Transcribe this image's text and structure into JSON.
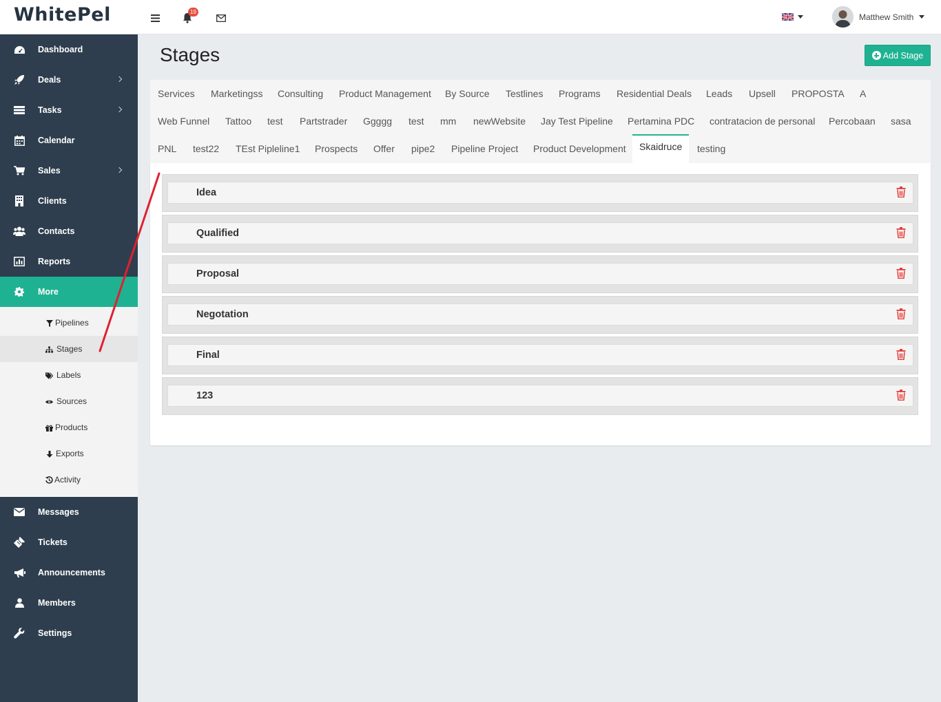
{
  "app": {
    "logo": "WhitePel"
  },
  "topbar": {
    "notification_count": "19",
    "user_name": "Matthew Smith"
  },
  "sidebar": {
    "items": [
      {
        "label": "Dashboard",
        "icon": "dashboard-icon"
      },
      {
        "label": "Deals",
        "icon": "rocket-icon"
      },
      {
        "label": "Tasks",
        "icon": "tasks-icon"
      },
      {
        "label": "Calendar",
        "icon": "calendar-icon"
      },
      {
        "label": "Sales",
        "icon": "cart-icon"
      },
      {
        "label": "Clients",
        "icon": "building-icon"
      },
      {
        "label": "Contacts",
        "icon": "users-icon"
      },
      {
        "label": "Reports",
        "icon": "bar-chart-icon"
      },
      {
        "label": "More",
        "icon": "gear-icon"
      },
      {
        "label": "Messages",
        "icon": "envelope-icon"
      },
      {
        "label": "Tickets",
        "icon": "ticket-icon"
      },
      {
        "label": "Announcements",
        "icon": "bullhorn-icon"
      },
      {
        "label": "Members",
        "icon": "user-icon"
      },
      {
        "label": "Settings",
        "icon": "wrench-icon"
      }
    ],
    "submenu": [
      {
        "label": "Pipelines",
        "icon": "filter-icon"
      },
      {
        "label": "Stages",
        "icon": "sitemap-icon"
      },
      {
        "label": "Labels",
        "icon": "tags-icon"
      },
      {
        "label": "Sources",
        "icon": "eye-icon"
      },
      {
        "label": "Products",
        "icon": "gift-icon"
      },
      {
        "label": "Exports",
        "icon": "arrow-down-icon"
      },
      {
        "label": "Activity",
        "icon": "history-icon"
      }
    ]
  },
  "page": {
    "title": "Stages",
    "add_button": "Add Stage"
  },
  "tabs": {
    "row1": [
      "Services",
      "Marketingss",
      "Consulting",
      "Product Management",
      "By Source",
      "Testlines",
      "Programs",
      "Residential Deals",
      "Leads",
      "Upsell",
      "PROPOSTA",
      "A"
    ],
    "row2": [
      "Web Funnel",
      "Tattoo",
      "test",
      "Partstrader",
      "Ggggg",
      "test",
      "mm",
      "newWebsite",
      "Jay Test Pipeline",
      "Pertamina PDC",
      "contratacion de personal",
      "Percobaan",
      "sasa"
    ],
    "row3": [
      "PNL",
      "test22",
      "TEst Pipleline1",
      "Prospects",
      "Offer",
      "pipe2",
      "Pipeline Project",
      "Product Development",
      "Skaidruce",
      "testing"
    ],
    "active": "Skaidruce"
  },
  "stages": [
    "Idea",
    "Qualified",
    "Proposal",
    "Negotation",
    "Final",
    "123"
  ],
  "colors": {
    "accent": "#1fb292",
    "sidebar": "#2e3e4e",
    "delete": "#e53935",
    "annotation": "#e02030"
  }
}
